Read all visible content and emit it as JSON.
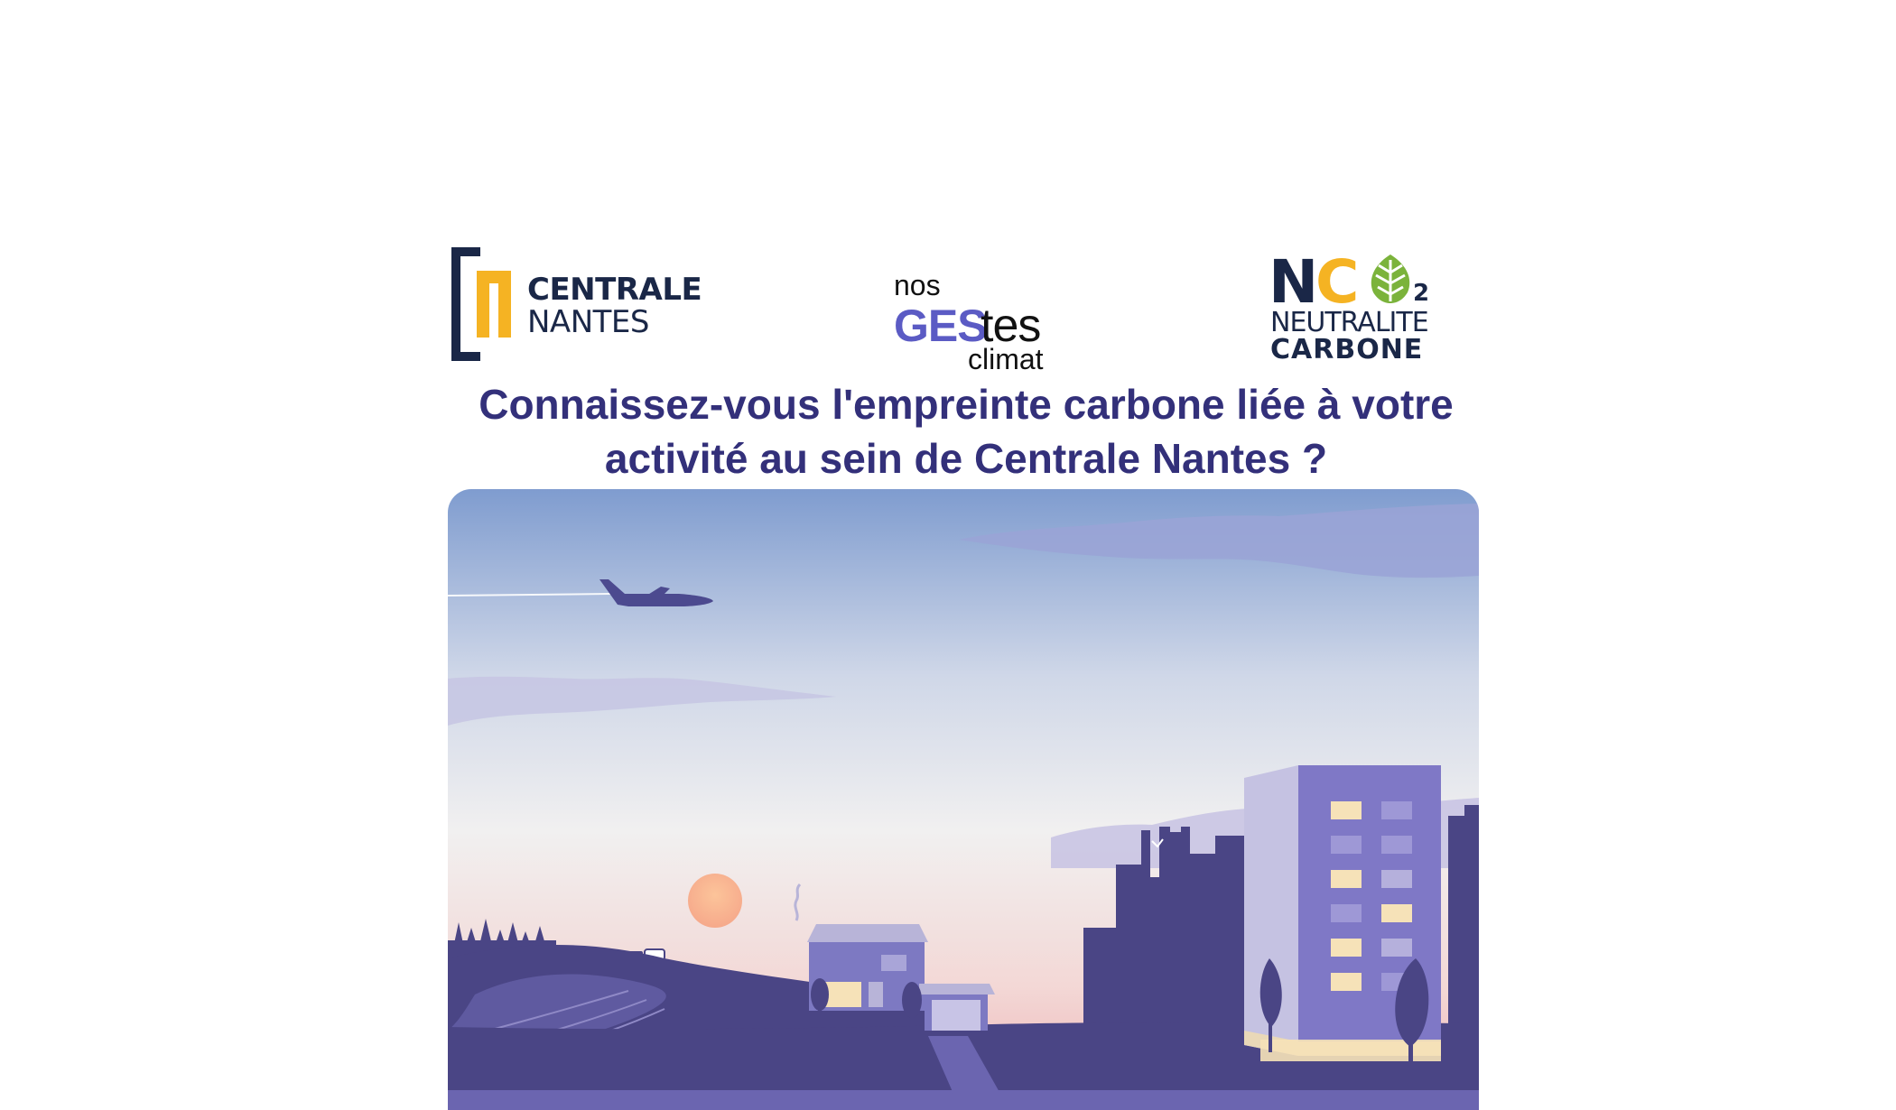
{
  "logos": {
    "centrale_nantes": {
      "line1": "CENTRALE",
      "line2": "NANTES"
    },
    "nos_gestes_climat": {
      "nos": "nos",
      "ges": "GES",
      "tes": "tes",
      "climat": "climat"
    },
    "neutralite_carbone": {
      "n": "N",
      "c": "C",
      "sub": "2",
      "line1": "NEUTRALITE",
      "line2": "CARBONE"
    }
  },
  "headline": {
    "line1": "Connaissez-vous l'empreinte carbone liée à votre",
    "line2": "activité au sein de Centrale Nantes ?"
  },
  "colors": {
    "brand_navy": "#1a2747",
    "brand_yellow": "#f5b323",
    "title_purple": "#33307a",
    "ges_blue": "#5b5bc4",
    "leaf_green": "#7bb33b"
  },
  "icons": {
    "airplane": "airplane-icon",
    "sun": "sun-icon",
    "house": "house-icon",
    "building": "building-icon",
    "leaf": "leaf-icon"
  }
}
